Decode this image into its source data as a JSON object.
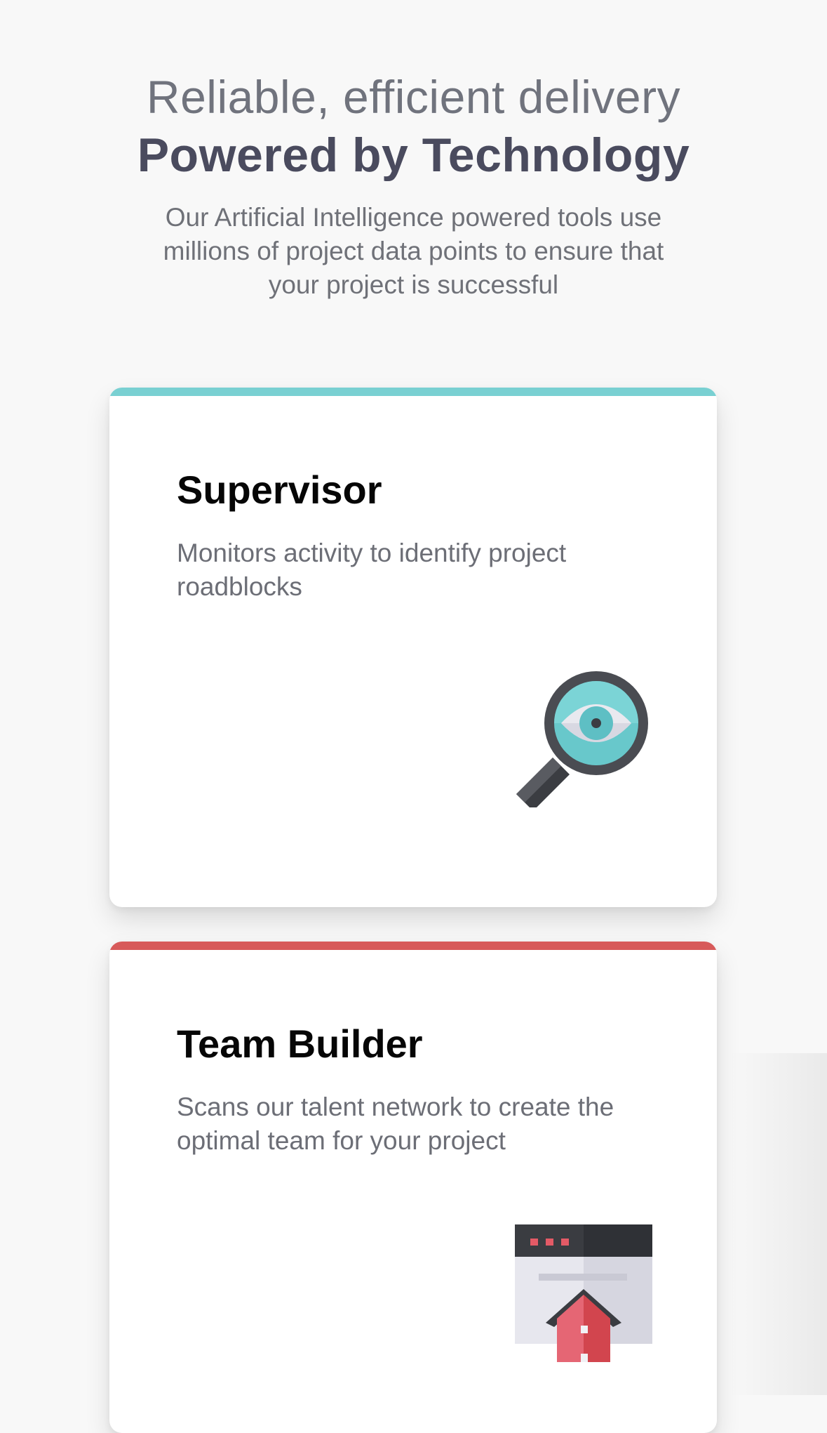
{
  "hero": {
    "kicker": "Reliable, efficient delivery",
    "title": "Powered by Technology",
    "subtitle": "Our Artificial Intelligence powered tools use millions of project data points to ensure that your project is successful"
  },
  "cards": [
    {
      "title": "Supervisor",
      "description": "Monitors activity to identify project roadblocks",
      "accent_color": "#79d0d2",
      "icon": "magnifier-eye-icon"
    },
    {
      "title": "Team Builder",
      "description": "Scans our talent network to create the optimal team for your project",
      "accent_color": "#d75a5a",
      "icon": "browser-house-icon"
    }
  ]
}
